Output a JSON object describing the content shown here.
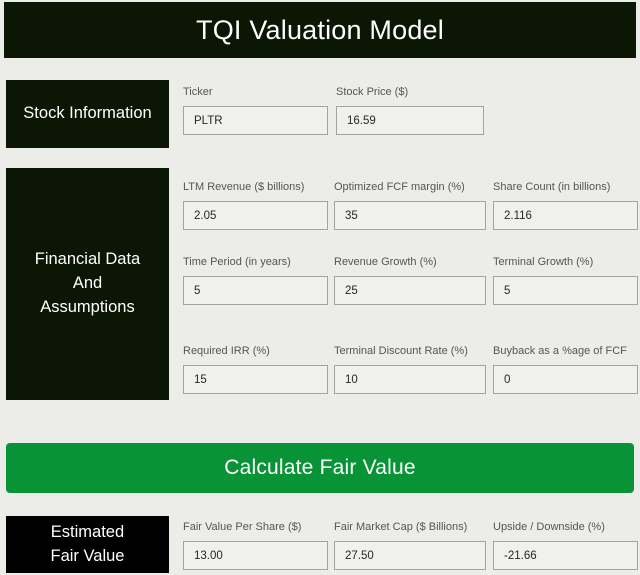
{
  "header": {
    "title": "TQI Valuation Model",
    "background_color": "#0c1605",
    "text_color": "#ffffff"
  },
  "theme": {
    "page_background": "#ecece8",
    "dark_panel": "#0c1605",
    "black_panel": "#000000",
    "accent_green": "#099337",
    "input_background": "#f0f0ec",
    "input_border": "#a3a39f",
    "label_text": "#555553"
  },
  "sections": {
    "stock_information": {
      "label": "Stock Information",
      "fields": [
        {
          "label": "Ticker",
          "value": "PLTR"
        },
        {
          "label": "Stock Price ($)",
          "value": "16.59"
        }
      ]
    },
    "financial_data": {
      "label": "Financial Data And Assumptions",
      "label_line_1": "Financial Data",
      "label_line_2": "And",
      "label_line_3": "Assumptions",
      "row1": [
        {
          "label": "LTM Revenue ($ billions)",
          "value": "2.05"
        },
        {
          "label": "Optimized FCF margin (%)",
          "value": "35"
        },
        {
          "label": "Share Count (in billions)",
          "value": "2.116"
        }
      ],
      "row2": [
        {
          "label": "Time Period (in years)",
          "value": "5"
        },
        {
          "label": "Revenue Growth (%)",
          "value": "25"
        },
        {
          "label": "Terminal Growth (%)",
          "value": "5"
        }
      ],
      "row3": [
        {
          "label": "Required IRR (%)",
          "value": "15"
        },
        {
          "label": "Terminal Discount Rate (%)",
          "value": "10"
        },
        {
          "label": "Buyback as a %age of FCF",
          "value": "0"
        }
      ]
    },
    "estimated_fair_value": {
      "label": "Estimated Fair Value",
      "label_line_1": "Estimated",
      "label_line_2": "Fair Value",
      "fields": [
        {
          "label": "Fair Value Per Share ($)",
          "value": "13.00"
        },
        {
          "label": "Fair Market Cap ($ Billions)",
          "value": "27.50"
        },
        {
          "label": "Upside / Downside (%)",
          "value": "-21.66"
        }
      ]
    }
  },
  "actions": {
    "calculate_button": "Calculate Fair Value"
  }
}
